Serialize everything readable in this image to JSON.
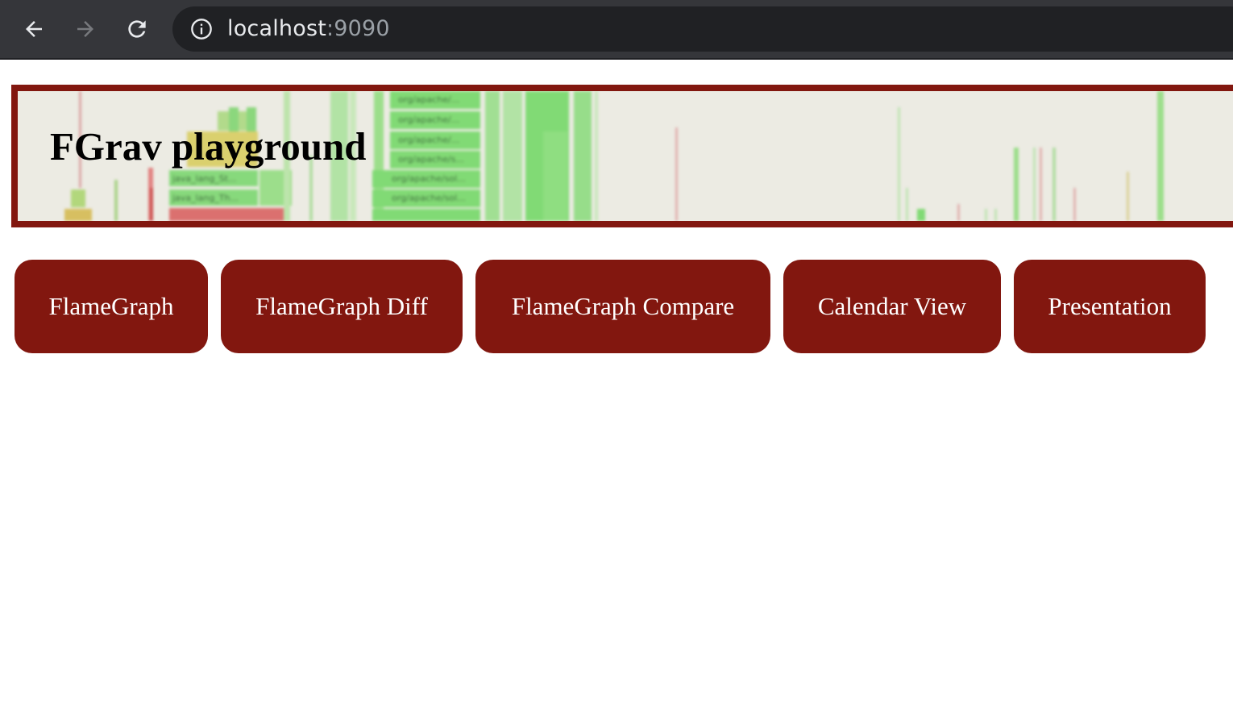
{
  "browser": {
    "url_host": "localhost",
    "url_port": ":9090",
    "back_icon": "arrow-left-icon",
    "forward_icon": "arrow-right-icon",
    "reload_icon": "reload-icon",
    "site_info_icon": "info-circle-icon"
  },
  "banner": {
    "title": "FGrav playground",
    "border_color": "#82170f",
    "background_color": "#ecebe3"
  },
  "nav_buttons": [
    {
      "label": "FlameGraph"
    },
    {
      "label": "FlameGraph Diff"
    },
    {
      "label": "FlameGraph Compare"
    },
    {
      "label": "Calendar View"
    },
    {
      "label": "Presentation"
    }
  ],
  "colors": {
    "button_bg": "#82170f",
    "button_text": "#ffffff",
    "toolbar_bg": "#35363a",
    "omnibox_bg": "#202124"
  }
}
